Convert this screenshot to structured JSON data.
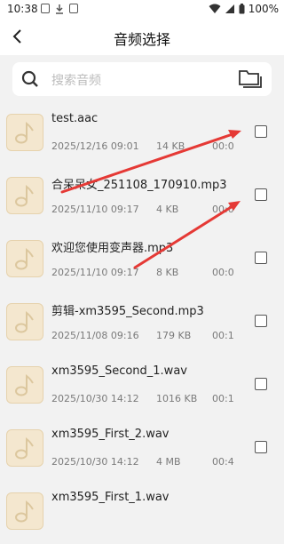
{
  "status_bar": {
    "time": "10:38",
    "battery": "100%"
  },
  "header": {
    "title": "音频选择"
  },
  "search": {
    "placeholder": "搜索音频"
  },
  "files": [
    {
      "name": "test.aac",
      "date": "2025/12/16 09:01",
      "size": "14 KB",
      "duration": "00:0"
    },
    {
      "name": "合呆呆女_251108_170910.mp3",
      "date": "2025/11/10 09:17",
      "size": "4 KB",
      "duration": "00:0"
    },
    {
      "name": "欢迎您使用变声器.mp3",
      "date": "2025/11/10 09:17",
      "size": "8 KB",
      "duration": "00:0"
    },
    {
      "name": "剪辑-xm3595_Second.mp3",
      "date": "2025/11/08 09:16",
      "size": "179 KB",
      "duration": "00:1"
    },
    {
      "name": "xm3595_Second_1.wav",
      "date": "2025/10/30 14:12",
      "size": "1016 KB",
      "duration": "00:1"
    },
    {
      "name": "xm3595_First_2.wav",
      "date": "2025/10/30 14:12",
      "size": "4 MB",
      "duration": "00:4"
    },
    {
      "name": "xm3595_First_1.wav",
      "date": "",
      "size": "",
      "duration": ""
    }
  ],
  "colors": {
    "annotation_arrow": "#e53935",
    "thumbnail_bg": "#f4e7cf",
    "note_icon": "#dcc79e"
  }
}
